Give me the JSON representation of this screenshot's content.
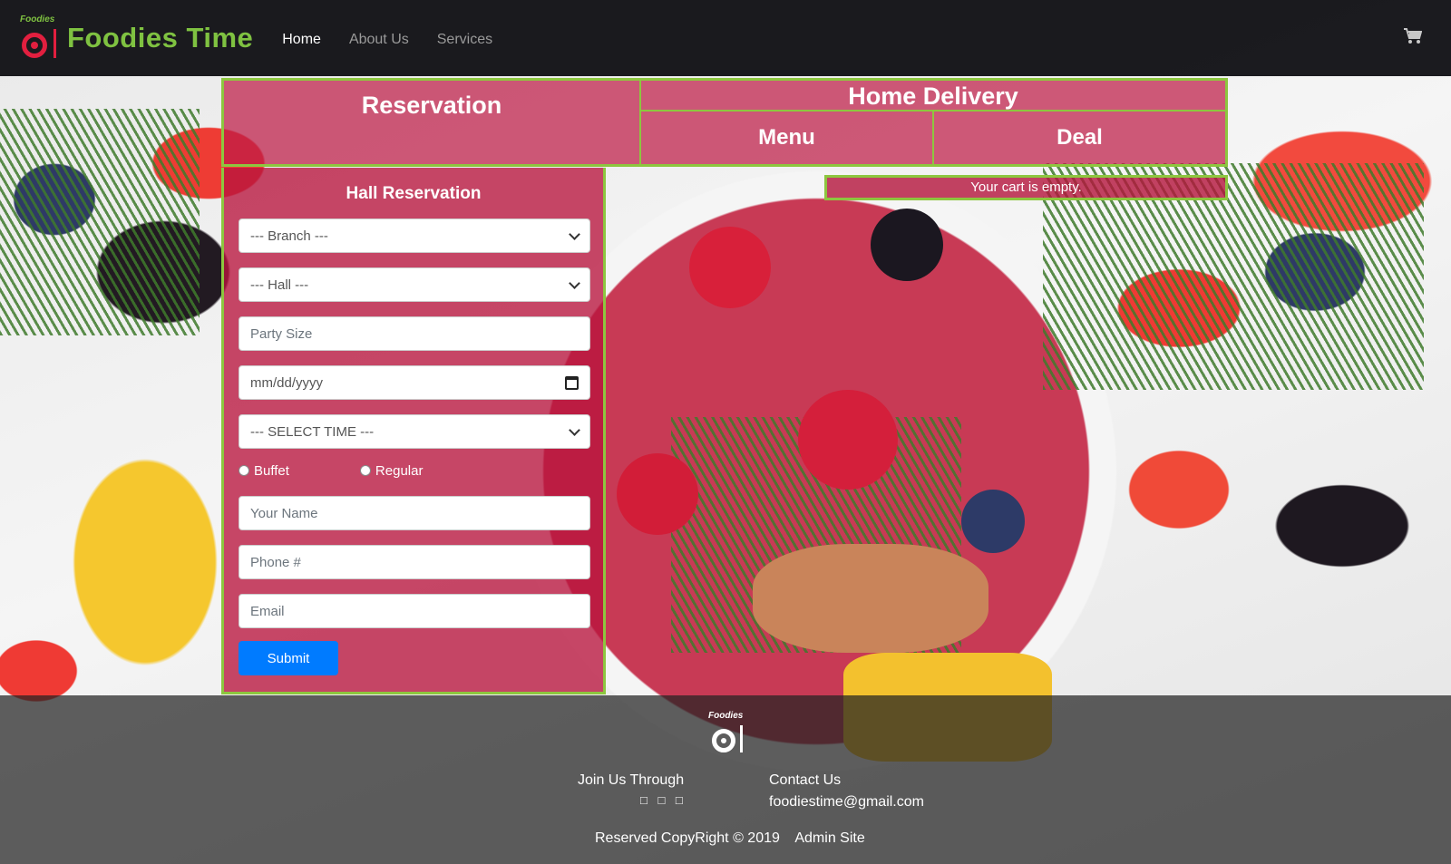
{
  "navbar": {
    "logo_small_text": "Foodies",
    "brand": "Foodies Time",
    "links": [
      {
        "label": "Home",
        "active": true
      },
      {
        "label": "About Us",
        "active": false
      },
      {
        "label": "Services",
        "active": false
      }
    ],
    "cart_icon": "shopping-cart-icon"
  },
  "tabs": {
    "reservation": "Reservation",
    "home_delivery": "Home Delivery",
    "menu": "Menu",
    "deal": "Deal"
  },
  "cart_notice": "Your cart is empty.",
  "form": {
    "title": "Hall Reservation",
    "branch_select": "--- Branch ---",
    "hall_select": "--- Hall ---",
    "party_size_placeholder": "Party Size",
    "date_placeholder": "mm/dd/yyyy",
    "time_select": "--- SELECT TIME ---",
    "radio_buffet": "Buffet",
    "radio_regular": "Regular",
    "name_placeholder": "Your Name",
    "phone_placeholder": "Phone #",
    "email_placeholder": "Email",
    "submit": "Submit"
  },
  "footer": {
    "logo_small_text": "Foodies",
    "join_label": "Join Us Through",
    "social_icons": "□ □ □",
    "contact_label": "Contact Us",
    "email": "foodiestime@gmail.com",
    "copyright": "Reserved CopyRight © 2019",
    "admin_link": "Admin Site"
  },
  "colors": {
    "accent_green": "#8dc63f",
    "brand_green": "#7fc241",
    "panel_red": "#be1c46",
    "submit_blue": "#007bff"
  }
}
